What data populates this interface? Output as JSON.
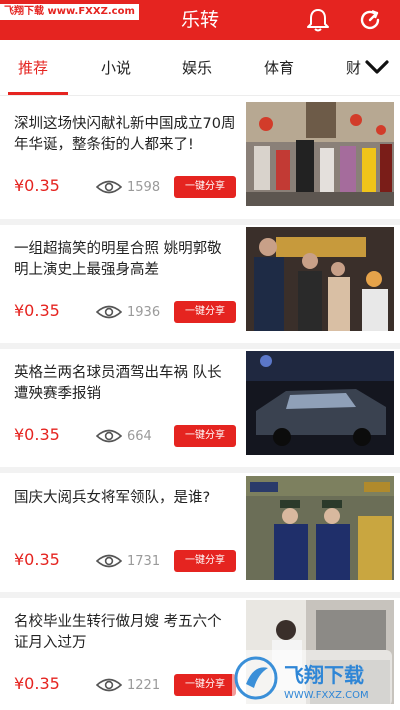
{
  "watermark_top": "飞翔下载 www.FXXZ.com",
  "header": {
    "title": "乐转"
  },
  "tabs": [
    {
      "label": "推荐",
      "active": true
    },
    {
      "label": "小说"
    },
    {
      "label": "娱乐"
    },
    {
      "label": "体育"
    },
    {
      "label": "财"
    }
  ],
  "feed": [
    {
      "title": "深圳这场快闪献礼新中国成立70周年华诞，整条街的人都来了!",
      "price": "¥0.35",
      "views": "1598",
      "share": "一键分享"
    },
    {
      "title": "一组超搞笑的明星合照 姚明郭敬明上演史上最强身高差",
      "price": "¥0.35",
      "views": "1936",
      "share": "一键分享"
    },
    {
      "title": "英格兰两名球员酒驾出车祸 队长遭殃赛季报销",
      "price": "¥0.35",
      "views": "664",
      "share": "一键分享"
    },
    {
      "title": "国庆大阅兵女将军领队，是谁?",
      "price": "¥0.35",
      "views": "1731",
      "share": "一键分享"
    },
    {
      "title": "名校毕业生转行做月嫂 考五六个证月入过万",
      "price": "¥0.35",
      "views": "1221",
      "share": "一键分享"
    }
  ],
  "watermark_bottom": {
    "brand": "飞翔下载",
    "url": "WWW.FXXZ.COM"
  },
  "colors": {
    "accent": "#e52420",
    "text": "#222222",
    "muted": "#9a9a9a",
    "divider": "#f2f2f2"
  },
  "icons": [
    "bell-icon",
    "refresh-icon",
    "chevron-down-icon",
    "eye-icon"
  ]
}
